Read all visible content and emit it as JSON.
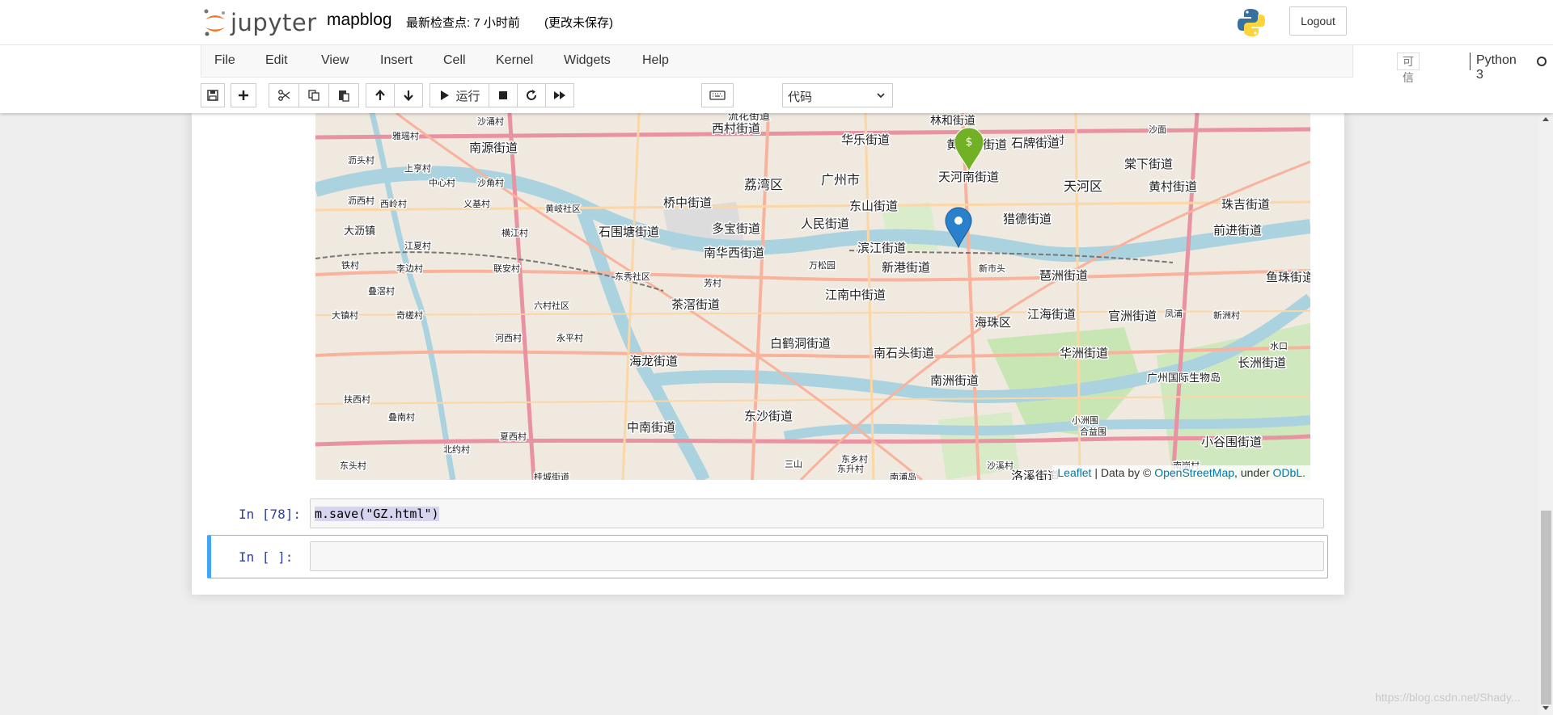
{
  "header": {
    "logo_text": "jupyter",
    "notebook_name": "mapblog",
    "checkpoint": "最新检查点: 7 小时前",
    "unsaved": "(更改未保存)",
    "logout_label": "Logout"
  },
  "menubar": {
    "items": [
      "File",
      "Edit",
      "View",
      "Insert",
      "Cell",
      "Kernel",
      "Widgets",
      "Help"
    ],
    "trusted": "可信",
    "kernel": "Python 3"
  },
  "toolbar": {
    "run_label": "运行",
    "cell_type": "代码",
    "icons": [
      "save-icon",
      "plus-icon",
      "cut-icon",
      "copy-icon",
      "paste-icon",
      "arrow-up-icon",
      "arrow-down-icon",
      "play-icon",
      "stop-icon",
      "restart-icon",
      "fast-forward-icon",
      "keyboard-icon"
    ]
  },
  "map": {
    "labels": [
      "流花街道",
      "林和街道",
      "雅瑶村",
      "沙涌村",
      "西村街道",
      "华乐街道",
      "黄花岗街道",
      "冼村",
      "石牌街道",
      "棠下街道",
      "沥头村",
      "上亨村",
      "南源街道",
      "天河南街道",
      "天河区",
      "黄村街道",
      "中心村",
      "沙角村",
      "荔湾区",
      "广州市",
      "沙面",
      "珠吉街道",
      "沥西村",
      "西岭村",
      "义基村",
      "黄岐社区",
      "桥中街道",
      "东山街道",
      "猎德街道",
      "大沥镇",
      "石围塘街道",
      "多宝街道",
      "人民街道",
      "滨江街道",
      "前进街道",
      "江夏村",
      "横江村",
      "南华西街道",
      "新港街道",
      "新市头",
      "琶洲街道",
      "铁村",
      "李边村",
      "联安村",
      "东秀社区",
      "芳村",
      "万松园",
      "鱼珠街道",
      "叠滘村",
      "六村社区",
      "茶滘街道",
      "江南中街道",
      "江海街道",
      "官洲街道",
      "大镇村",
      "奇槎村",
      "海珠区",
      "凤浦",
      "新洲村",
      "河西村",
      "永平村",
      "白鹤洞街道",
      "南石头街道",
      "华洲街道",
      "长洲街道",
      "水口",
      "海龙街道",
      "南洲街道",
      "广州国际生物岛",
      "扶西村",
      "叠南村",
      "东沙街道",
      "小洲围",
      "夏西村",
      "中南街道",
      "合益围",
      "小谷围街道",
      "北约村",
      "东头村",
      "南岗村",
      "东乡村",
      "沙溪村",
      "东升村",
      "南浦岛",
      "洛溪街道",
      "桂城街道",
      "三山"
    ],
    "attribution": {
      "leaflet": "Leaflet",
      "data_by": " | Data by © ",
      "osm": "OpenStreetMap",
      "under": ", under ",
      "odbl": "ODbL."
    },
    "markers": [
      {
        "name": "green-marker",
        "color": "#72b026"
      },
      {
        "name": "blue-marker",
        "color": "#38aadd"
      }
    ]
  },
  "cells": [
    {
      "prompt": "In  [78]:",
      "code": "m.save(\"GZ.html\")"
    },
    {
      "prompt": "In  [ ]:",
      "code": ""
    }
  ],
  "watermark": "https://blog.csdn.net/Shady..."
}
